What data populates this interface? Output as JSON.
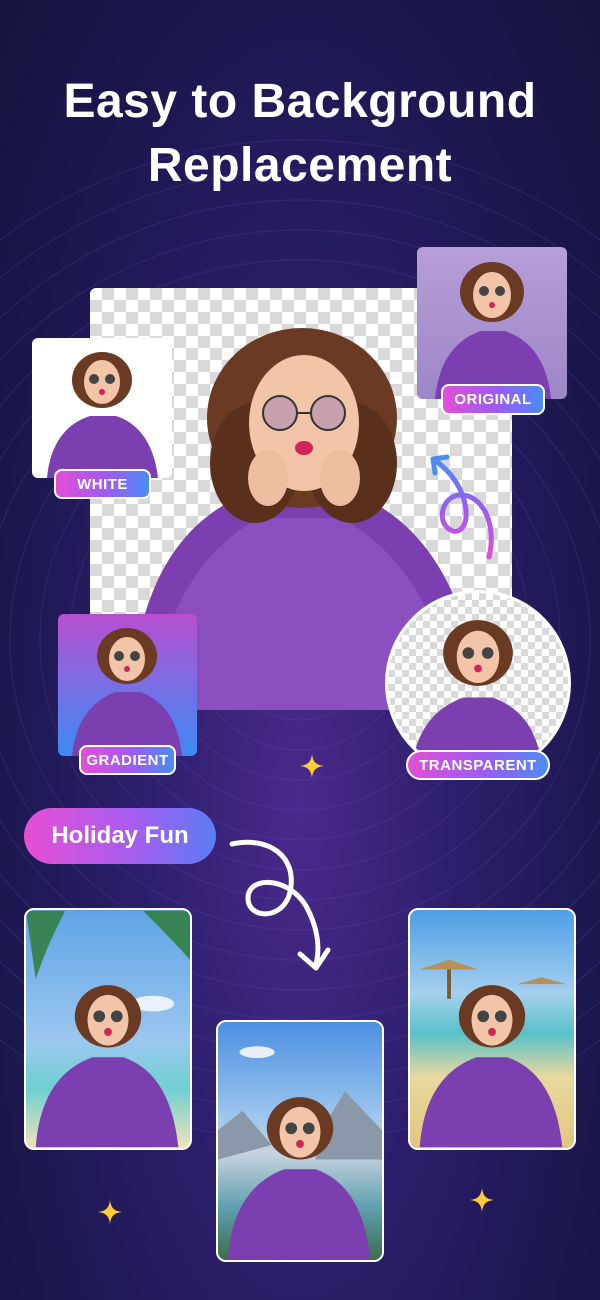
{
  "header": {
    "title_line1": "Easy to Background",
    "title_line2": "Replacement"
  },
  "labels": {
    "white": "WHITE",
    "original": "ORIGINAL",
    "gradient": "GRADIENT",
    "transparent": "TRANSPARENT"
  },
  "section": {
    "holiday_label": "Holiday Fun"
  },
  "colors": {
    "accent_pink": "#e24fd6",
    "accent_purple": "#9b5cf0",
    "accent_blue": "#4b8cf5",
    "sparkle": "#ffcc33",
    "fur": "#7b3fb0"
  },
  "icons": [
    "curved-arrow-icon",
    "sparkle-icon",
    "person-illustration"
  ]
}
